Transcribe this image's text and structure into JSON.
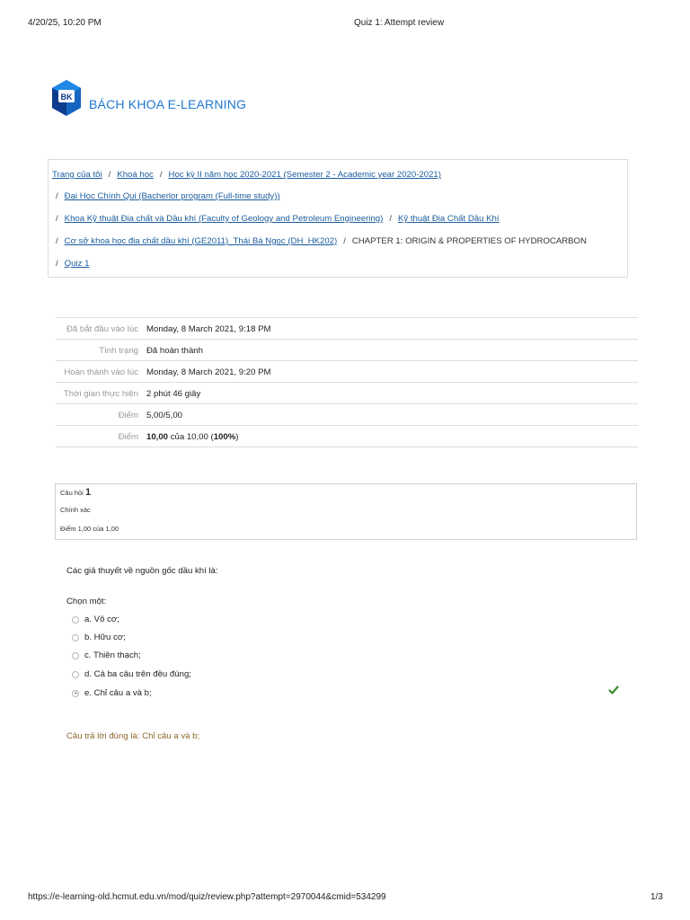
{
  "print_header": {
    "datetime": "4/20/25, 10:20 PM",
    "title": "Quiz 1: Attempt review"
  },
  "brand": {
    "logo_text": "BK",
    "name": "BÁCH KHOA E-LEARNING",
    "colors": {
      "logo_blue": "#1565c0",
      "logo_dark": "#0d3b8e",
      "brand_text": "#1f77d0"
    }
  },
  "breadcrumb": {
    "separator": "/",
    "items": [
      "Trang của tôi",
      "Khoá học",
      "Học kỳ II năm học 2020-2021 (Semester 2 - Academic year 2020-2021)",
      "Đại Học Chính Qui (Bacherlor program (Full-time study))",
      "Khoa Kỹ thuật Địa chất và Dầu khí (Faculty of Geology and Petroleum Engineering)",
      "Kỹ thuật Địa Chất Dầu Khí",
      "Cơ sở khoa học địa chất dầu khí (GE2011)_Thái Bá Ngọc (DH_HK202)",
      "CHAPTER 1: ORIGIN & PROPERTIES OF HYDROCARBON",
      "Quiz 1"
    ]
  },
  "summary": {
    "rows": [
      {
        "label": "Đã bắt đầu vào lúc",
        "value": "Monday, 8 March 2021, 9:18 PM"
      },
      {
        "label": "Tình trạng",
        "value": "Đã hoàn thành"
      },
      {
        "label": "Hoàn thành vào lúc",
        "value": "Monday, 8 March 2021, 9:20 PM"
      },
      {
        "label": "Thời gian thực hiện",
        "value": "2 phút 46 giây"
      },
      {
        "label": "Điểm",
        "value": "5,00/5,00"
      }
    ],
    "grade": {
      "label": "Điểm",
      "score": "10,00",
      "of": "của",
      "total": "10,00",
      "percent": "100%"
    }
  },
  "question": {
    "number_label": "Câu hỏi",
    "number": "1",
    "state": "Chính xác",
    "mark": "Điểm 1,00 của 1,00",
    "text": "Các giả thuyết về nguồn gốc dầu khí là:",
    "prompt": "Chọn một:",
    "options": [
      {
        "label": "a. Vô cơ;"
      },
      {
        "label": "b. Hữu cơ;"
      },
      {
        "label": "c. Thiên thạch;"
      },
      {
        "label": "d. Cả ba câu trên đều đúng;"
      },
      {
        "label": "e. Chỉ câu a và b;"
      }
    ],
    "selected_index": 4,
    "correct_icon": "check-icon",
    "right_answer": "Câu trả lời đúng là: Chỉ câu a và b;",
    "colors": {
      "check": "#3c8a2e",
      "right_answer": "#8e662e"
    }
  },
  "print_footer": {
    "url": "https://e-learning-old.hcmut.edu.vn/mod/quiz/review.php?attempt=2970044&cmid=534299",
    "page": "1/3"
  }
}
